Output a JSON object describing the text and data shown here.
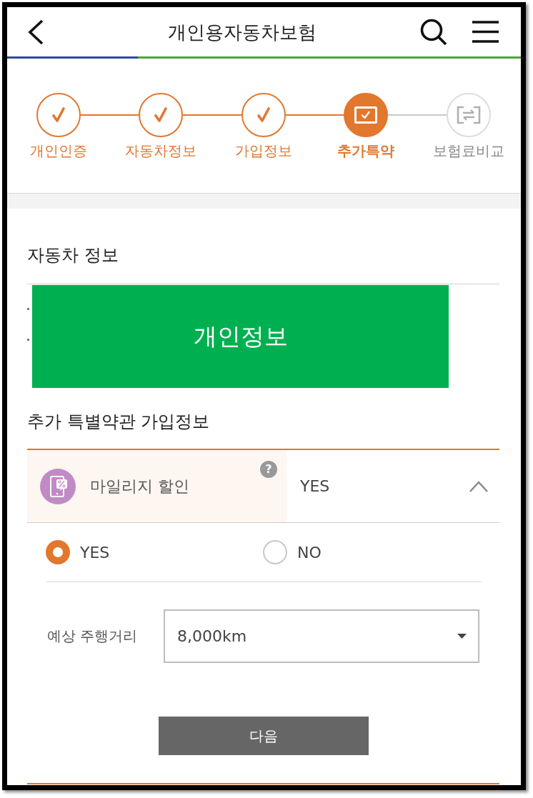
{
  "header": {
    "title": "개인용자동차보험"
  },
  "progress": {
    "level": 0.255
  },
  "steps": [
    {
      "label": "개인인증",
      "kind": "check",
      "done": true,
      "selected": false
    },
    {
      "label": "자동차정보",
      "kind": "check",
      "done": true,
      "selected": false
    },
    {
      "label": "가입정보",
      "kind": "check",
      "done": true,
      "selected": false
    },
    {
      "label": "추가특약",
      "kind": "screen",
      "done": false,
      "selected": true
    },
    {
      "label": "보험료비교",
      "kind": "compare",
      "done": false,
      "selected": false
    }
  ],
  "vehicle_info": {
    "title": "자동차 정보",
    "rows": [
      {
        "kind": "bullet"
      },
      {
        "kind": "bullet"
      }
    ],
    "redaction": {
      "label": "개인정보"
    }
  },
  "special_terms": {
    "title": "추가 특별약관 가입정보",
    "items": [
      {
        "label": "마일리지 할인",
        "help": "?",
        "value": "YES",
        "expanded": true,
        "choices": [
          {
            "label": "YES",
            "selected": true
          },
          {
            "label": "NO",
            "selected": false
          }
        ],
        "fields": [
          {
            "label": "예상 주행거리",
            "value": "8,000km"
          }
        ]
      }
    ]
  },
  "next_button": {
    "label": "다음"
  }
}
